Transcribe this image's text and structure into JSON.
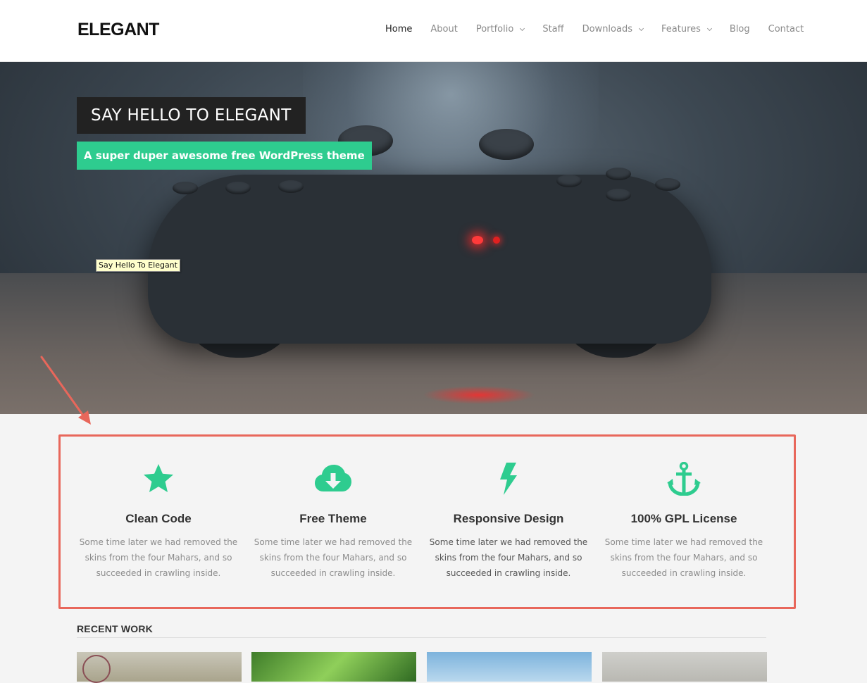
{
  "header": {
    "logo": "ELEGANT",
    "nav": [
      {
        "label": "Home",
        "active": true,
        "dropdown": false
      },
      {
        "label": "About",
        "active": false,
        "dropdown": false
      },
      {
        "label": "Portfolio",
        "active": false,
        "dropdown": true
      },
      {
        "label": "Staff",
        "active": false,
        "dropdown": false
      },
      {
        "label": "Downloads",
        "active": false,
        "dropdown": true
      },
      {
        "label": "Features",
        "active": false,
        "dropdown": true
      },
      {
        "label": "Blog",
        "active": false,
        "dropdown": false
      },
      {
        "label": "Contact",
        "active": false,
        "dropdown": false
      }
    ]
  },
  "hero": {
    "title": "SAY HELLO TO ELEGANT",
    "subtitle": "A super duper awesome free WordPress theme",
    "tooltip": "Say Hello To Elegant"
  },
  "features": [
    {
      "icon": "star-icon",
      "title": "Clean Code",
      "text": "Some time later we had removed the skins from the four Mahars, and so succeeded in crawling inside."
    },
    {
      "icon": "cloud-download-icon",
      "title": "Free Theme",
      "text": "Some time later we had removed the skins from the four Mahars, and so succeeded in crawling inside."
    },
    {
      "icon": "lightning-bolt-icon",
      "title": "Responsive Design",
      "text": "Some time later we had removed the skins from the four Mahars, and so succeeded in crawling inside."
    },
    {
      "icon": "anchor-icon",
      "title": "100% GPL License",
      "text": "Some time later we had removed the skins from the four Mahars, and so succeeded in crawling inside."
    }
  ],
  "recent_work": {
    "title": "RECENT WORK"
  },
  "colors": {
    "accent": "#2ecc8f",
    "annotation": "#e8675b",
    "hero_title_bg": "#222222"
  }
}
